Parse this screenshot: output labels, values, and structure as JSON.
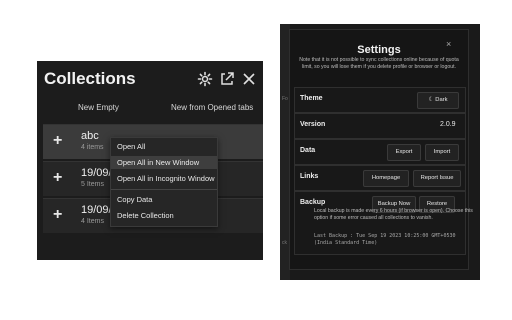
{
  "collections": {
    "title": "Collections",
    "actions": {
      "new_empty": "New Empty",
      "new_from_tabs": "New from Opened tabs"
    },
    "items": [
      {
        "name": "abc",
        "count": "4 items"
      },
      {
        "name": "19/09/2",
        "count": "5 Items"
      },
      {
        "name": "19/09/2",
        "count": "4 Items"
      }
    ],
    "context_menu": {
      "open_all": "Open All",
      "open_new_window": "Open All in New Window",
      "open_incognito": "Open All in Incognito Window",
      "copy_data": "Copy Data",
      "delete": "Delete Collection"
    }
  },
  "settings": {
    "title": "Settings",
    "close": "×",
    "note": "Note that it is not possible to sync collections online because of quota limit, so you will lose them if you delete profile or browser or logout.",
    "theme": {
      "label": "Theme",
      "value": "Dark"
    },
    "version": {
      "label": "Version",
      "value": "2.0.9"
    },
    "data": {
      "label": "Data",
      "export": "Export",
      "import": "Import"
    },
    "links": {
      "label": "Links",
      "homepage": "Homepage",
      "report": "Report Issue"
    },
    "backup": {
      "label": "Backup",
      "backup_now": "Backup Now",
      "restore": "Restore",
      "note": "Local backup is made every 6 hours (if browser is open). Choose this option if some error caused all collections to vanish.",
      "last_backup": "Last Backup : Tue Sep 19 2023 10:25:00 GMT+0530 (India Standard Time)"
    }
  }
}
